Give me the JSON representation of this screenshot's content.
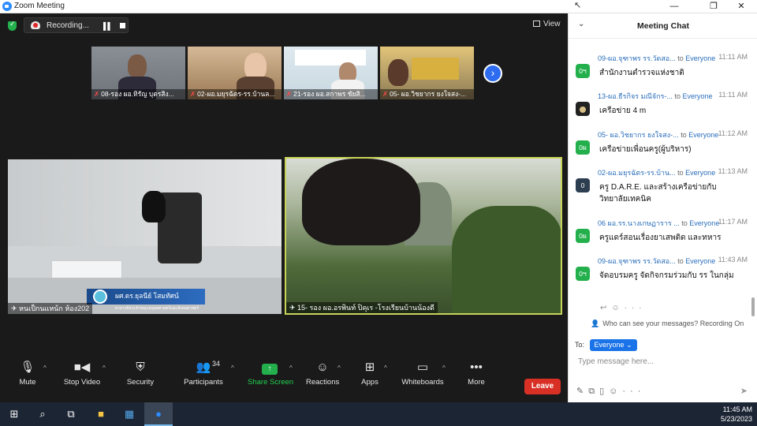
{
  "window": {
    "title": "Zoom Meeting"
  },
  "top_bar": {
    "recording_label": "Recording...",
    "view_label": "View"
  },
  "thumbnails": [
    {
      "name": "08-รอง ผอ.ทิรัญ บุตรสิง..."
    },
    {
      "name": "02-ผอ.มยุรฉัตร-รร.บ้านล..."
    },
    {
      "name": "21-รอง ผอ.สกาพร ชัยสิ..."
    },
    {
      "name": "05- ผอ.วิชยากร ยงใจสง-..."
    }
  ],
  "main_videos": {
    "left": {
      "name": "หนเป็กนแหน้ก ห้อง202",
      "banner": "ผศ.ดร.ยุลนีย์ โสมทัศน์",
      "banner_sub": "อาจารย์ประจำคณะมนุษยศาสตร์และสังคมศาสตร์"
    },
    "right": {
      "name": "15- รอง ผอ.อรพินท์ ปิคุเร -โรงเรียนบ้านน้องดี"
    }
  },
  "toolbar": {
    "mute": "Mute",
    "stop_video": "Stop Video",
    "security": "Security",
    "participants": "Participants",
    "participants_count": "34",
    "share_screen": "Share Screen",
    "reactions": "Reactions",
    "apps": "Apps",
    "whiteboards": "Whiteboards",
    "more": "More",
    "leave": "Leave"
  },
  "chat": {
    "title": "Meeting Chat",
    "messages": [
      {
        "avatar": "0ฯ",
        "avatar_color": "#23b04c",
        "sender": "09-ผอ.จุฑาพร  รร.วัดสอ...",
        "to": "to",
        "recipient": "Everyone",
        "time": "11:11 AM",
        "text": "สำนักงานตำรวจแห่งชาติ"
      },
      {
        "avatar": "",
        "avatar_color": "#222222",
        "sender": "13-ผอ.ธีรกิจร มณีจักร-...",
        "to": "to",
        "recipient": "Everyone",
        "time": "11:11 AM",
        "text": "เครือข่าย 4 m"
      },
      {
        "avatar": "0ผ",
        "avatar_color": "#23b04c",
        "sender": "05- ผอ.วิชยากร ยงใจสง-...",
        "to": "to",
        "recipient": "Everyone",
        "time": "11:12 AM",
        "text": "เครือข่ายเพื่อนครู(ผู้บริหาร)"
      },
      {
        "avatar": "0",
        "avatar_color": "#2c3e50",
        "sender": "02-ผอ.มยุรฉัตร-รร.บ้าน...",
        "to": "to",
        "recipient": "Everyone",
        "time": "11:13 AM",
        "text": "ครู D.A.R.E.  และสร้างเครือข่ายกับวิทยาลัยเทคนิค"
      },
      {
        "avatar": "0ผ",
        "avatar_color": "#23b04c",
        "sender": "06 ผอ.รร.นางเกษฏาราร ...",
        "to": "to",
        "recipient": "Everyone",
        "time": "11:17 AM",
        "text": "ครูแดร์สอนเรื่องยาเสพติด และทหาร"
      },
      {
        "avatar": "0ฯ",
        "avatar_color": "#23b04c",
        "sender": "09-ผอ.จุฑาพร  รร.วัดสอ...",
        "to": "to",
        "recipient": "Everyone",
        "time": "11:43 AM",
        "text": "จัดอบรมครู จัดกิจกรมร่วมกับ รร ในกลุ่ม"
      }
    ],
    "privacy_note": "Who can see your messages? Recording On",
    "to_label": "To:",
    "to_value": "Everyone",
    "input_placeholder": "Type message here..."
  },
  "taskbar": {
    "time": "11:45 AM",
    "date": "5/23/2023"
  }
}
